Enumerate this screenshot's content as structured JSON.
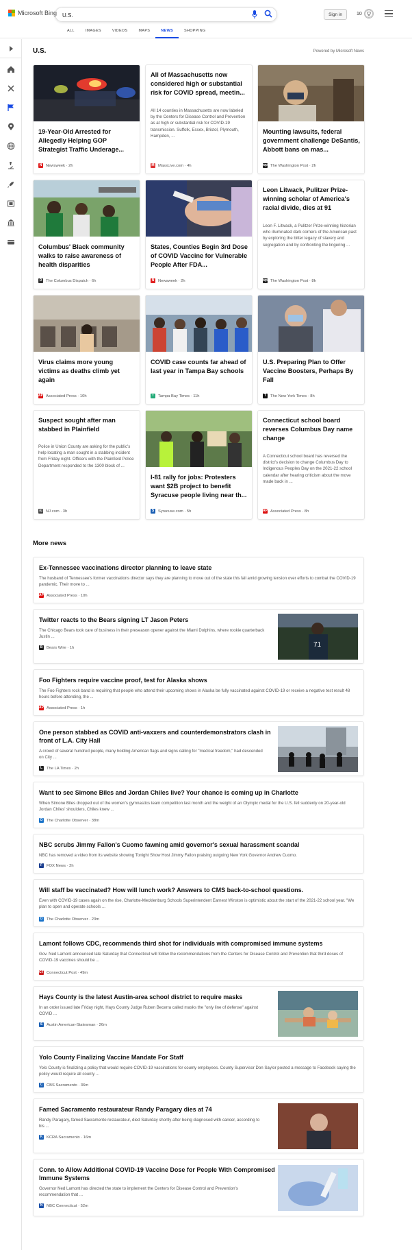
{
  "header": {
    "logo_text": "Microsoft Bing",
    "search_value": "U.S.",
    "signin_label": "Sign in",
    "rewards_count": "10",
    "tabs": [
      "ALL",
      "IMAGES",
      "VIDEOS",
      "MAPS",
      "NEWS",
      "SHOPPING"
    ],
    "active_tab": "NEWS"
  },
  "colors": {
    "accent": "#174ae4",
    "logo": [
      "#f25022",
      "#7fba00",
      "#00a4ef",
      "#ffb900"
    ]
  },
  "rail_icons": [
    "chevron-right-icon",
    "home-icon",
    "tools-icon",
    "flag-icon",
    "location-icon",
    "globe-icon",
    "microscope-icon",
    "rocket-icon",
    "film-icon",
    "bank-icon",
    "card-icon"
  ],
  "page": {
    "title": "U.S.",
    "powered_by": "Powered by Microsoft News"
  },
  "cards": [
    {
      "title": "19-Year-Old Arrested for Allegedly Helping GOP Strategist Traffic Underage...",
      "desc": "",
      "source": "Newsweek · 2h",
      "src_letter": "N",
      "src_color": "#e02020"
    },
    {
      "title": "All of Massachusetts now considered high or substantial risk for COVID spread, meetin...",
      "desc": "All 14 counties in Massachusetts are now labeled by the Centers for Disease Control and Prevention as at high or substantial risk for COVID-19 transmission. Suffolk, Essex, Bristol, Plymouth, Hampden, ...",
      "source": "MassLive.com · 4h",
      "src_letter": "M",
      "src_color": "#d33"
    },
    {
      "title": "Mounting lawsuits, federal government challenge DeSantis, Abbott bans on mas...",
      "desc": "",
      "source": "The Washington Post · 2h",
      "src_letter": "wp",
      "src_color": "#222"
    },
    {
      "title": "Columbus' Black community walks to raise awareness of health disparities",
      "desc": "",
      "source": "The Columbus Dispatch · 6h",
      "src_letter": "D",
      "src_color": "#333"
    },
    {
      "title": "States, Counties Begin 3rd Dose of COVID Vaccine for Vulnerable People After FDA...",
      "desc": "",
      "source": "Newsweek · 2h",
      "src_letter": "N",
      "src_color": "#e02020"
    },
    {
      "title": "Leon Litwack, Pulitzer Prize-winning scholar of America's racial divide, dies at 91",
      "desc": "Leon F. Litwack, a Pulitzer Prize-winning historian who illuminated dark corners of the American past by exploring the bitter legacy of slavery and segregation and by confronting the lingering ...",
      "source": "The Washington Post · 8h",
      "src_letter": "wp",
      "src_color": "#222"
    },
    {
      "title": "Virus claims more young victims as deaths climb yet again",
      "desc": "",
      "source": "Associated Press · 10h",
      "src_letter": "AP",
      "src_color": "#d11"
    },
    {
      "title": "COVID case counts far ahead of last year in Tampa Bay schools",
      "desc": "",
      "source": "Tampa Bay Times · 11h",
      "src_letter": "t",
      "src_color": "#2a7"
    },
    {
      "title": "U.S. Preparing Plan to Offer Vaccine Boosters, Perhaps By Fall",
      "desc": "",
      "source": "The New York Times · 8h",
      "src_letter": "T",
      "src_color": "#111"
    },
    {
      "title": "Suspect sought after man stabbed in Plainfield",
      "desc": "Police in Union County are asking for the public's help locating a man sought in a stabbing incident from Friday night. Officers with the Plainfield Police Department responded to the 1300 block of ...",
      "source": "NJ.com · 3h",
      "src_letter": "nj",
      "src_color": "#444"
    },
    {
      "title": "I-81 rally for jobs: Protesters want $2B project to benefit Syracuse people living near th...",
      "desc": "",
      "source": "Syracuse.com · 5h",
      "src_letter": "S",
      "src_color": "#1a5fb4"
    },
    {
      "title": "Connecticut school board reverses Columbus Day name change",
      "desc": "A Connecticut school board has reversed the district's decision to change Columbus Day to Indigenous Peoples Day on the 2021-22 school calendar after hearing criticism about the move made back in ...",
      "source": "Associated Press · 8h",
      "src_letter": "AP",
      "src_color": "#d11"
    }
  ],
  "more_news": {
    "title": "More news",
    "items": [
      {
        "title": "Ex-Tennessee vaccinations director planning to leave state",
        "desc": "The husband of Tennessee's former vaccinations director says they are planning to move out of the state this fall amid growing tension over efforts to combat the COVID-19 pandemic. Their move to ...",
        "source": "Associated Press · 10h",
        "src_letter": "AP",
        "src_color": "#d11"
      },
      {
        "title": "Twitter reacts to the Bears signing LT Jason Peters",
        "desc": "The Chicago Bears took care of business in their preseason opener against the Miami Dolphins, where rookie quarterback Justin ...",
        "source": "Bears Wire · 1h",
        "src_letter": "B",
        "src_color": "#222"
      },
      {
        "title": "Foo Fighters require vaccine proof, test for Alaska shows",
        "desc": "The Foo Fighters rock band is requiring that people who attend their upcoming shows in Alaska be fully vaccinated against COVID-19 or receive a negative test result 48 hours before attending, the ...",
        "source": "Associated Press · 1h",
        "src_letter": "AP",
        "src_color": "#d11"
      },
      {
        "title": "One person stabbed as COVID anti-vaxxers and counterdemonstrators clash in front of L.A. City Hall",
        "desc": "A crowd of several hundred people, many holding American flags and signs calling for \"medical freedom,\" had descended on City ...",
        "source": "The LA Times · 2h",
        "src_letter": "L",
        "src_color": "#222"
      },
      {
        "title": "Want to see Simone Biles and Jordan Chiles live? Your chance is coming up in Charlotte",
        "desc": "When Simone Biles dropped out of the women's gymnastics team competition last month and the weight of an Olympic medal for the U.S. fell suddenly on 20-year-old Jordan Chiles' shoulders, Chiles knew ...",
        "source": "The Charlotte Observer · 38m",
        "src_letter": "O",
        "src_color": "#1a73c9"
      },
      {
        "title": "NBC scrubs Jimmy Fallon's Cuomo fawning amid governor's sexual harassment scandal",
        "desc": "NBC has removed a video from its website showing Tonight Show Host Jimmy Fallon praising outgoing New York Governor Andrew Cuomo.",
        "source": "FOX News · 2h",
        "src_letter": "F",
        "src_color": "#1a3d8f"
      },
      {
        "title": "Will staff be vaccinated? How will lunch work? Answers to CMS back-to-school questions.",
        "desc": "Even with COVID-19 cases again on the rise, Charlotte-Mecklenburg Schools Superintendent Earnest Winston is optimistic about the start of the 2021-22 school year. \"We plan to open and operate schools ...",
        "source": "The Charlotte Observer · 23m",
        "src_letter": "O",
        "src_color": "#1a73c9"
      },
      {
        "title": "Lamont follows CDC, recommends third shot for individuals with compromised immune systems",
        "desc": "Gov. Ned Lamont announced late Saturday that Connecticut will follow the recommendations from the Centers for Disease Control and Prevention that third doses of COVID-19 vaccines should be ...",
        "source": "Connecticut Post · 49m",
        "src_letter": "CT",
        "src_color": "#c22"
      },
      {
        "title": "Hays County is the latest Austin-area school district to require masks",
        "desc": "In an order issued late Friday night, Hays County Judge Ruben Becerra called masks the \"only line of defense\" against COVID ...",
        "source": "Austin American-Statesman · 26m",
        "src_letter": "S",
        "src_color": "#1a5fb4"
      },
      {
        "title": "Yolo County Finalizing Vaccine Mandate For Staff",
        "desc": "Yolo County is finalizing a policy that would require COVID-19 vaccinations for county employees. County Supervisor Don Saylor posted a message to Facebook saying the policy would require all county ...",
        "source": "CBS Sacramento · 36m",
        "src_letter": "C",
        "src_color": "#1a5fb4"
      },
      {
        "title": "Famed Sacramento restaurateur Randy Paragary dies at 74",
        "desc": "Randy Paragary, famed Sacramento restaurateur, died Saturday shortly after being diagnosed with cancer, according to his ...",
        "source": "KCRA Sacramento · 16m",
        "src_letter": "K",
        "src_color": "#1a5fb4"
      },
      {
        "title": "Conn. to Allow Additional COVID-19 Vaccine Dose for People With Compromised Immune Systems",
        "desc": "Governor Ned Lamont has directed the state to implement the Centers for Disease Control and Prevention's recommendation that ...",
        "source": "NBC Connecticut · 52m",
        "src_letter": "N",
        "src_color": "#1a4fa8"
      }
    ]
  }
}
